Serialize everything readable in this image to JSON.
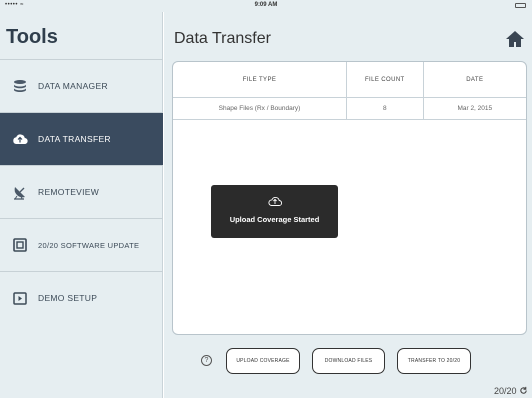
{
  "status_bar": {
    "carrier": "••••• ≈",
    "time": "9:09 AM"
  },
  "sidebar": {
    "title": "Tools",
    "items": [
      {
        "label": "DATA MANAGER",
        "icon": "database-icon",
        "active": false
      },
      {
        "label": "DATA TRANSFER",
        "icon": "cloud-icon",
        "active": true
      },
      {
        "label": "REMOTEVIEW",
        "icon": "satellite-dish-icon",
        "active": false
      },
      {
        "label": "20/20 SOFTWARE UPDATE",
        "icon": "monitor-icon",
        "active": false
      },
      {
        "label": "DEMO SETUP",
        "icon": "play-screen-icon",
        "active": false
      }
    ]
  },
  "main": {
    "title": "Data Transfer",
    "home_icon": "home-icon"
  },
  "table": {
    "headers": [
      "FILE TYPE",
      "FILE COUNT",
      "DATE"
    ],
    "rows": [
      [
        "Shape Files (Rx / Boundary)",
        "8",
        "Mar 2, 2015"
      ]
    ]
  },
  "toast": {
    "text": "Upload Coverage Started",
    "icon": "cloud-upload-icon"
  },
  "actions": {
    "help": "?",
    "upload": "UPLOAD COVERAGE",
    "download": "DOWNLOAD FILES",
    "transfer": "TRANSFER TO 20/20"
  },
  "footer": {
    "version": "20/20"
  },
  "colors": {
    "sidebar_bg": "#e6eef1",
    "active_bg": "#3a4b5f",
    "toast_bg": "#2b2b2b"
  }
}
